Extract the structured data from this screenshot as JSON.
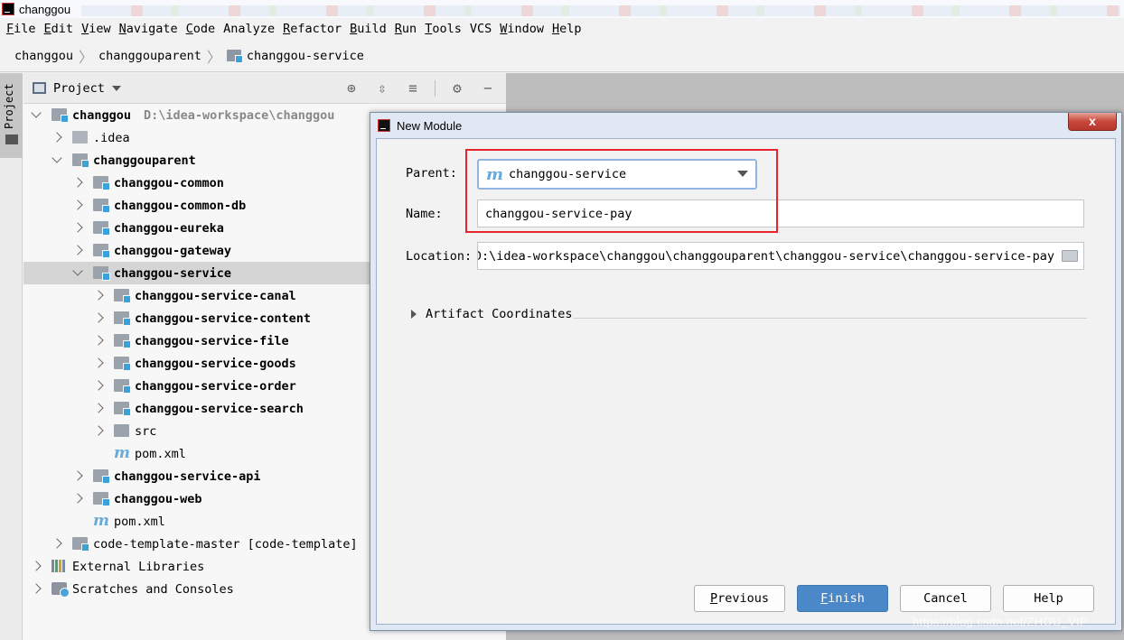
{
  "window": {
    "title": "changgou"
  },
  "menu": [
    {
      "mnemonic": "F",
      "rest": "ile"
    },
    {
      "mnemonic": "E",
      "rest": "dit"
    },
    {
      "mnemonic": "V",
      "rest": "iew"
    },
    {
      "mnemonic": "N",
      "rest": "avigate"
    },
    {
      "mnemonic": "C",
      "rest": "ode"
    },
    {
      "mnemonic": "",
      "rest": "Analyze"
    },
    {
      "mnemonic": "R",
      "rest": "efactor"
    },
    {
      "mnemonic": "B",
      "rest": "uild"
    },
    {
      "mnemonic": "R",
      "rest": "un"
    },
    {
      "mnemonic": "T",
      "rest": "ools"
    },
    {
      "mnemonic": "",
      "rest": "VCS"
    },
    {
      "mnemonic": "W",
      "rest": "indow"
    },
    {
      "mnemonic": "H",
      "rest": "elp"
    }
  ],
  "breadcrumb": [
    "changgou",
    "changgouparent",
    "changgou-service"
  ],
  "side_tab": {
    "label": "Project"
  },
  "panel": {
    "title": "Project"
  },
  "tree": [
    {
      "label": "changgou",
      "path": "D:\\idea-workspace\\changgou",
      "depth": 0,
      "chevron": "down",
      "icon": "module",
      "bold": true
    },
    {
      "label": ".idea",
      "depth": 1,
      "chevron": "right",
      "icon": "folder-plain"
    },
    {
      "label": "changgouparent",
      "depth": 1,
      "chevron": "down",
      "icon": "module",
      "bold": true
    },
    {
      "label": "changgou-common",
      "depth": 2,
      "chevron": "right",
      "icon": "module",
      "bold": true
    },
    {
      "label": "changgou-common-db",
      "depth": 2,
      "chevron": "right",
      "icon": "module",
      "bold": true
    },
    {
      "label": "changgou-eureka",
      "depth": 2,
      "chevron": "right",
      "icon": "module",
      "bold": true
    },
    {
      "label": "changgou-gateway",
      "depth": 2,
      "chevron": "right",
      "icon": "module",
      "bold": true
    },
    {
      "label": "changgou-service",
      "depth": 2,
      "chevron": "down",
      "icon": "module",
      "bold": true,
      "selected": true
    },
    {
      "label": "changgou-service-canal",
      "depth": 3,
      "chevron": "right",
      "icon": "module",
      "bold": true
    },
    {
      "label": "changgou-service-content",
      "depth": 3,
      "chevron": "right",
      "icon": "module",
      "bold": true
    },
    {
      "label": "changgou-service-file",
      "depth": 3,
      "chevron": "right",
      "icon": "module",
      "bold": true
    },
    {
      "label": "changgou-service-goods",
      "depth": 3,
      "chevron": "right",
      "icon": "module",
      "bold": true
    },
    {
      "label": "changgou-service-order",
      "depth": 3,
      "chevron": "right",
      "icon": "module",
      "bold": true
    },
    {
      "label": "changgou-service-search",
      "depth": 3,
      "chevron": "right",
      "icon": "module",
      "bold": true
    },
    {
      "label": "src",
      "depth": 3,
      "chevron": "right",
      "icon": "folder"
    },
    {
      "label": "pom.xml",
      "depth": 3,
      "chevron": "",
      "icon": "maven"
    },
    {
      "label": "changgou-service-api",
      "depth": 2,
      "chevron": "right",
      "icon": "module",
      "bold": true
    },
    {
      "label": "changgou-web",
      "depth": 2,
      "chevron": "right",
      "icon": "module",
      "bold": true
    },
    {
      "label": "pom.xml",
      "depth": 2,
      "chevron": "",
      "icon": "maven"
    },
    {
      "label": "code-template-master [code-template]",
      "depth": 1,
      "chevron": "right",
      "icon": "module"
    },
    {
      "label": "External Libraries",
      "depth": 0,
      "chevron": "right",
      "icon": "libs"
    },
    {
      "label": "Scratches and Consoles",
      "depth": 0,
      "chevron": "right",
      "icon": "scratch"
    }
  ],
  "dialog": {
    "title": "New Module",
    "close_label": "x",
    "parent_label": "Parent:",
    "parent_value": "changgou-service",
    "name_label": "Name:",
    "name_value": "changgou-service-pay",
    "location_label": "Location:",
    "location_value": "D:\\idea-workspace\\changgou\\changgouparent\\changgou-service\\changgou-service-pay",
    "artifact_label": "Artifact Coordinates",
    "buttons": {
      "previous": {
        "mnemonic": "P",
        "rest": "revious"
      },
      "finish": {
        "mnemonic": "F",
        "rest": "inish"
      },
      "cancel": {
        "mnemonic": "",
        "rest": "Cancel"
      },
      "help": {
        "mnemonic": "",
        "rest": "Help"
      }
    }
  },
  "watermark": "https://blog.csdn.net/ZHOU_VIP",
  "colors": {
    "accent": "#4a88c8",
    "highlight": "#e8232e",
    "maven": "#6aaad8",
    "module_badge": "#3aa2d8"
  }
}
